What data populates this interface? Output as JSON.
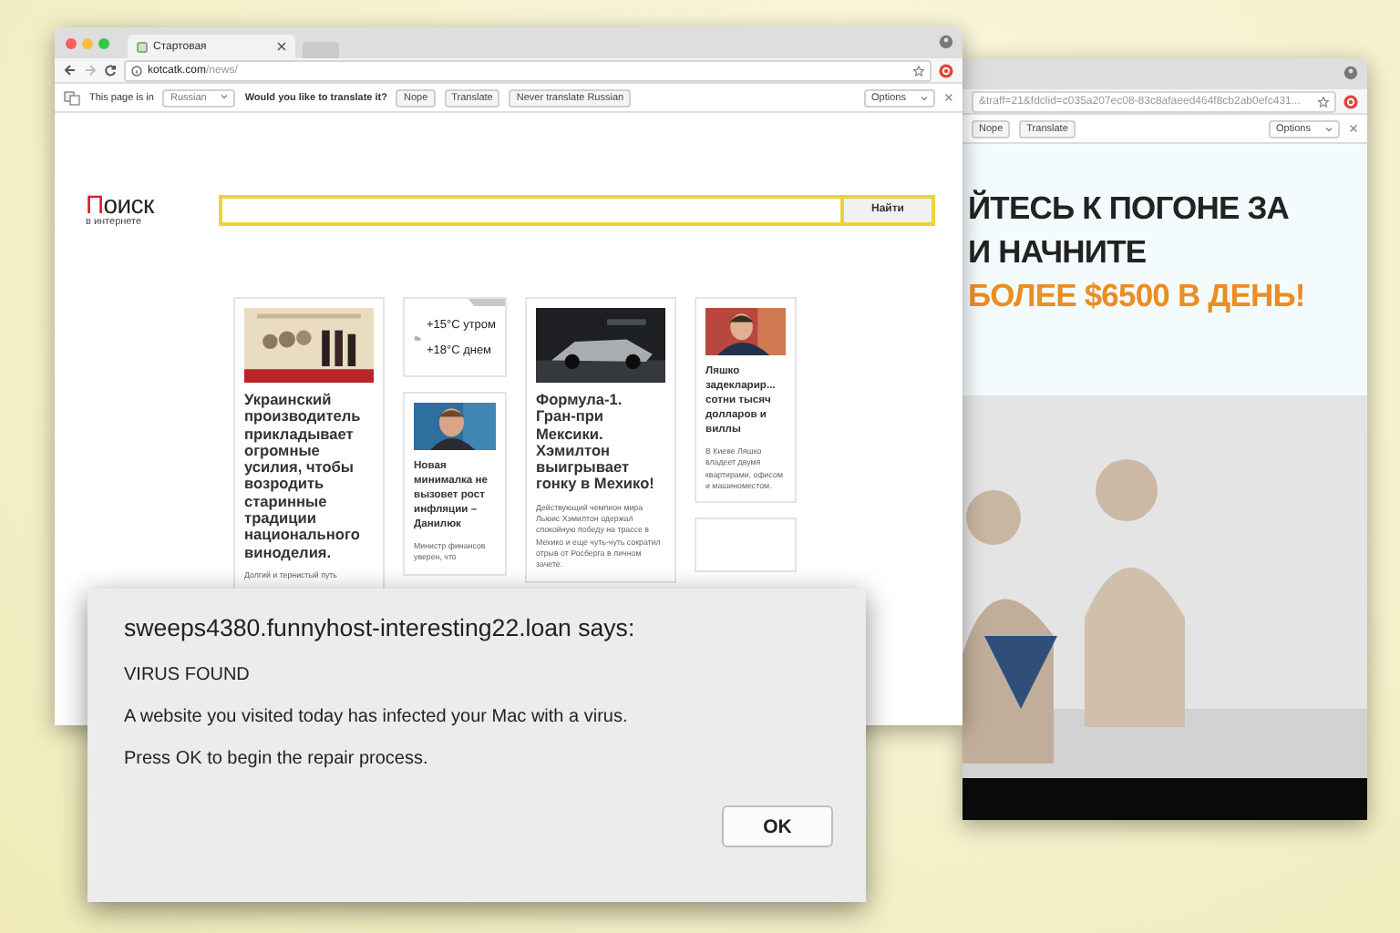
{
  "back_window": {
    "url": "&traff=21&fdclid=c035a207ec08-83c8afaeed464f8cb2ab0efc431...",
    "translate_bar": {
      "buttons": [
        "Nope",
        "Translate"
      ],
      "options": "Options"
    },
    "headline_lines": [
      {
        "text": "ЙТЕСЬ К ПОГОНЕ ЗА",
        "kind": "dark"
      },
      {
        "text": "И НАЧНИТЕ",
        "kind": "dark"
      },
      {
        "text": "БОЛЕЕ $6500 В ДЕНЬ!",
        "kind": "accent"
      }
    ]
  },
  "front_window": {
    "tab": {
      "title": "Стартовая"
    },
    "url": {
      "host": "kotcatk.com",
      "path": "/news/"
    },
    "translate_bar": {
      "prefix": "This page is in",
      "language": "Russian",
      "question": "Would you like to translate it?",
      "buttons": [
        "Nope",
        "Translate",
        "Never translate Russian"
      ],
      "options": "Options"
    },
    "logo": {
      "title": "Поиск",
      "subtitle": "в интернете"
    },
    "search": {
      "button": "Найти"
    },
    "columns": [
      [
        {
          "kind": "news",
          "title": "Украинский производитель прикладывает огромные усилия, чтобы возродить старинные традиции национального виноделия.",
          "snippet": "Долгий и тернистый путь"
        }
      ],
      [
        {
          "kind": "weather",
          "readings": [
            "+15°C утром",
            "+18°C днем"
          ]
        },
        {
          "kind": "news",
          "title": "Новая минималка не вызовет рост инфляции – Данилюк",
          "snippet": "Министр финансов уверен, что"
        }
      ],
      [
        {
          "kind": "news",
          "title": "Формула-1. Гран-при Мексики. Хэмилтон выигрывает гонку в Мехико!",
          "snippet": "Действующий чемпион мира Льюис Хэмилтон одержал спокойную победу на трассе в Мехико и еще чуть-чуть сократил отрыв от Росберга в личном зачете."
        }
      ],
      [
        {
          "kind": "news",
          "title": "Ляшко задекларир... сотни тысяч долларов и виллы",
          "snippet": "В Киеве Ляшко владеет двумя квартирами, офисом и машиноместом."
        },
        {
          "kind": "empty"
        }
      ]
    ]
  },
  "dialog": {
    "title": "sweeps4380.funnyhost-interesting22.loan says:",
    "heading": "VIRUS FOUND",
    "message": "A website you visited today has infected your Mac with a virus.",
    "instruction": "Press OK to begin the repair process.",
    "button": "OK"
  }
}
